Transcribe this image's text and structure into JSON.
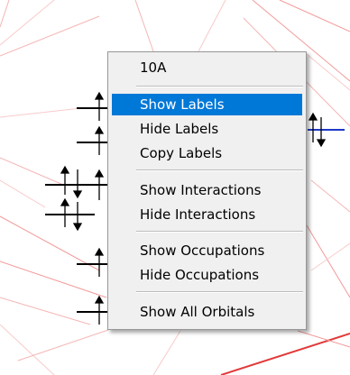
{
  "colors": {
    "background": "#ffffff",
    "pink_lines": "#f29a9a",
    "red_lines": "#e23a3a",
    "orbital_line": "#000000",
    "highlight_orbital": "#1d39c8",
    "menu_background": "#f0f0f0",
    "menu_highlight": "#0078d7"
  },
  "context_menu": {
    "title": "10A",
    "items": [
      {
        "label": "Show Labels",
        "highlighted": true
      },
      {
        "label": "Hide Labels"
      },
      {
        "label": "Copy Labels"
      },
      {
        "label": "Show Interactions"
      },
      {
        "label": "Hide Interactions"
      },
      {
        "label": "Show Occupations"
      },
      {
        "label": "Hide Occupations"
      },
      {
        "label": "Show All Orbitals"
      }
    ]
  }
}
